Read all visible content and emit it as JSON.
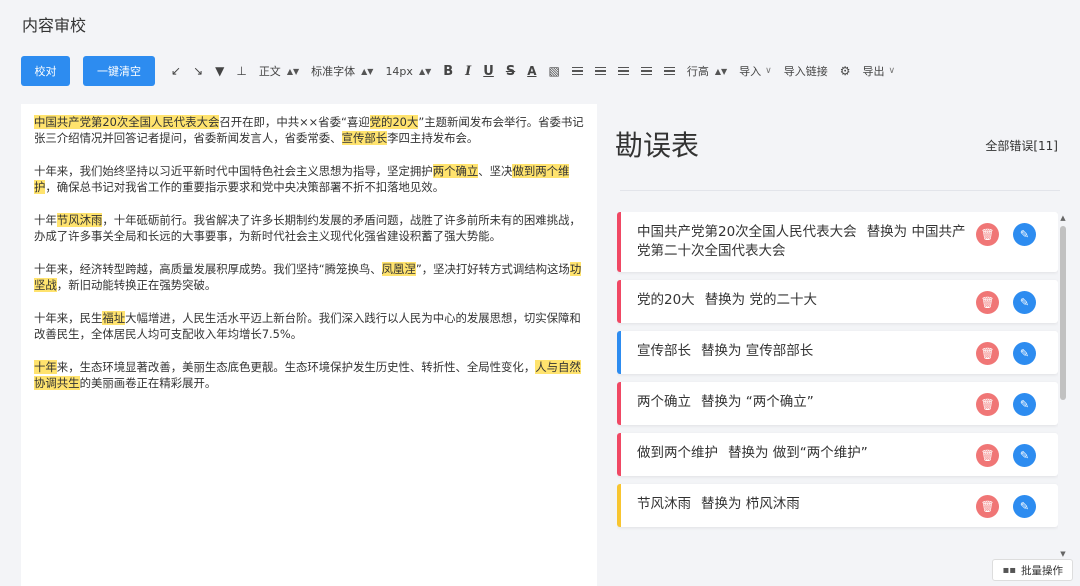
{
  "page": {
    "title": "内容审校"
  },
  "toolbar": {
    "check_label": "校对",
    "clear_label": "一键清空",
    "paragraph_format": "正文",
    "font_family": "标准字体",
    "font_size": "14px",
    "bold": "B",
    "italic": "I",
    "underline": "U",
    "strike": "S",
    "font_color": "A",
    "line_height": "行高",
    "import": "导入",
    "import_link": "导入链接",
    "export": "导出"
  },
  "editor": {
    "paragraphs": [
      {
        "segments": [
          {
            "text": "中国共产党第20次全国人民代表大会",
            "hl": true
          },
          {
            "text": "召开在即，中共××省委“喜迎",
            "hl": false
          },
          {
            "text": "党的20大",
            "hl": true
          },
          {
            "text": "”主题新闻发布会举行。省委书记张三介绍情况并回答记者提问，省委新闻发言人，省委常委、",
            "hl": false
          },
          {
            "text": "宣传部长",
            "hl": true
          },
          {
            "text": "李四主持发布会。",
            "hl": false
          }
        ]
      },
      {
        "segments": [
          {
            "text": "十年来，我们始终坚持以习近平新时代中国特色社会主义思想为指导，坚定拥护",
            "hl": false
          },
          {
            "text": "两个确立",
            "hl": true
          },
          {
            "text": "、坚决",
            "hl": false
          },
          {
            "text": "做到两个维护",
            "hl": true
          },
          {
            "text": "，确保总书记对我省工作的重要指示要求和党中央决策部署不折不扣落地见效。",
            "hl": false
          }
        ]
      },
      {
        "segments": [
          {
            "text": "十年",
            "hl": false
          },
          {
            "text": "节风沐雨",
            "hl": true
          },
          {
            "text": "，十年砥砺前行。我省解决了许多长期制约发展的矛盾问题，战胜了许多前所未有的困难挑战，办成了许多事关全局和长远的大事要事，为新时代社会主义现代化强省建设积蓄了强大势能。",
            "hl": false
          }
        ]
      },
      {
        "segments": [
          {
            "text": "十年来，经济转型跨越，高质量发展积厚成势。我们坚持“腾笼换鸟、",
            "hl": false
          },
          {
            "text": "凤凰",
            "hl": true
          },
          {
            "text": "涅",
            "hl": true
          },
          {
            "text": "”，坚决打好转方式调结构这场",
            "hl": false
          },
          {
            "text": "功坚战",
            "hl": true
          },
          {
            "text": "，新旧动能转换正在强势突破。",
            "hl": false
          }
        ]
      },
      {
        "segments": [
          {
            "text": "十年来，民生",
            "hl": false
          },
          {
            "text": "福址",
            "hl": true
          },
          {
            "text": "大幅增进，人民生活水平迈上新台阶。我们深入践行以人民为中心的发展思想，切实保障和改善民生，全体居民人均可支配收入年均增长7.5%。",
            "hl": false
          }
        ]
      },
      {
        "segments": [
          {
            "text": "十年",
            "hl": true
          },
          {
            "text": "来，生态环境显著改善，美丽生态底色更靓。生态环境保护发生历史性、转折性、全局性变化，",
            "hl": false
          },
          {
            "text": "人与自然协调共生",
            "hl": true
          },
          {
            "text": "的美丽画卷正在精彩展开。",
            "hl": false
          }
        ]
      }
    ]
  },
  "errors": {
    "title": "勘误表",
    "count_label": "全部错误[11]",
    "items": [
      {
        "from": "中国共产党第20次全国人民代表大会",
        "replace": "替换为 中国共产党第二十次全国代表大会",
        "color": "red"
      },
      {
        "from": "党的20大",
        "replace": "替换为 党的二十大",
        "color": "red"
      },
      {
        "from": "宣传部长",
        "replace": "替换为 宣传部部长",
        "color": "blue"
      },
      {
        "from": "两个确立",
        "replace": "替换为 “两个确立”",
        "color": "red"
      },
      {
        "from": "做到两个维护",
        "replace": "替换为 做到“两个维护”",
        "color": "red"
      },
      {
        "from": "节风沐雨",
        "replace": "替换为 栉风沐雨",
        "color": "yellow"
      }
    ]
  },
  "batch_label": "批量操作",
  "colors": {
    "primary": "#2d8cf0",
    "highlight": "#ffe36e",
    "error_red": "#f04864",
    "delete_btn": "#f07676"
  }
}
